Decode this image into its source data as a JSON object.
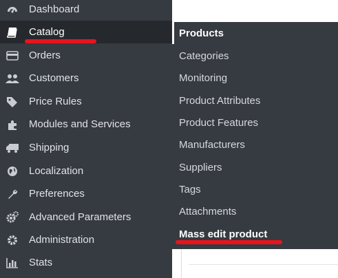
{
  "sidebar": {
    "items": [
      {
        "label": "Dashboard",
        "icon": "dashboard-icon"
      },
      {
        "label": "Catalog",
        "icon": "book-icon"
      },
      {
        "label": "Orders",
        "icon": "credit-card-icon"
      },
      {
        "label": "Customers",
        "icon": "users-icon"
      },
      {
        "label": "Price Rules",
        "icon": "tags-icon"
      },
      {
        "label": "Modules and Services",
        "icon": "puzzle-icon"
      },
      {
        "label": "Shipping",
        "icon": "truck-icon"
      },
      {
        "label": "Localization",
        "icon": "globe-icon"
      },
      {
        "label": "Preferences",
        "icon": "wrench-icon"
      },
      {
        "label": "Advanced Parameters",
        "icon": "cogs-icon"
      },
      {
        "label": "Administration",
        "icon": "gear-icon"
      },
      {
        "label": "Stats",
        "icon": "bar-chart-icon"
      }
    ]
  },
  "submenu": {
    "items": [
      {
        "label": "Products"
      },
      {
        "label": "Categories"
      },
      {
        "label": "Monitoring"
      },
      {
        "label": "Product Attributes"
      },
      {
        "label": "Product Features"
      },
      {
        "label": "Manufacturers"
      },
      {
        "label": "Suppliers"
      },
      {
        "label": "Tags"
      },
      {
        "label": "Attachments"
      },
      {
        "label": "Mass edit product"
      }
    ]
  },
  "colors": {
    "sidebar_bg": "#363a41",
    "active_bg": "#25292e",
    "annotation_red": "#e8141c"
  }
}
